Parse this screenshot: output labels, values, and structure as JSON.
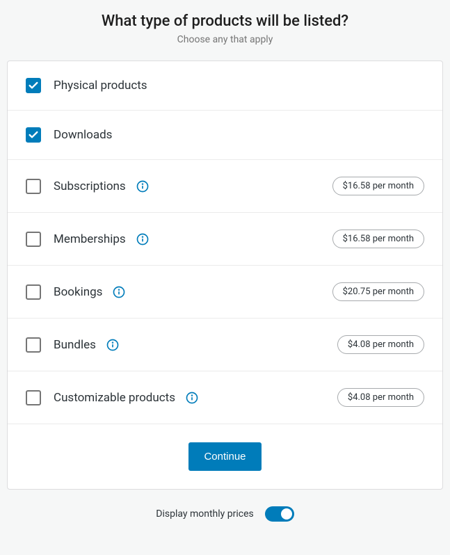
{
  "header": {
    "title": "What type of products will be listed?",
    "subtitle": "Choose any that apply"
  },
  "items": [
    {
      "label": "Physical products",
      "checked": true,
      "info": false,
      "price": null
    },
    {
      "label": "Downloads",
      "checked": true,
      "info": false,
      "price": null
    },
    {
      "label": "Subscriptions",
      "checked": false,
      "info": true,
      "price": "$16.58 per month"
    },
    {
      "label": "Memberships",
      "checked": false,
      "info": true,
      "price": "$16.58 per month"
    },
    {
      "label": "Bookings",
      "checked": false,
      "info": true,
      "price": "$20.75 per month"
    },
    {
      "label": "Bundles",
      "checked": false,
      "info": true,
      "price": "$4.08 per month"
    },
    {
      "label": "Customizable products",
      "checked": false,
      "info": true,
      "price": "$4.08 per month"
    }
  ],
  "actions": {
    "continue": "Continue"
  },
  "toggle": {
    "label": "Display monthly prices",
    "on": true
  }
}
